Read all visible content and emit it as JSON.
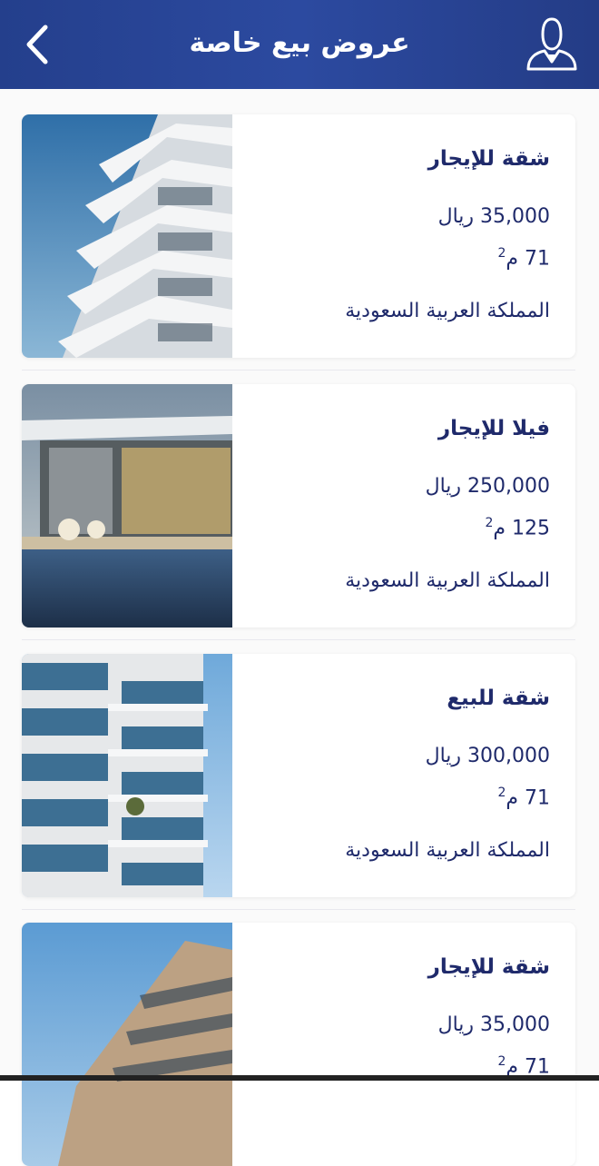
{
  "header": {
    "title": "عروض بيع خاصة",
    "back_icon": "chevron-left-icon",
    "profile_icon": "user-icon",
    "color": "#2c4aa0"
  },
  "listings": [
    {
      "title": "شقة للإيجار",
      "price": "35,000 ريال",
      "area": "71 م",
      "area_sup": "2",
      "location": "المملكة العربية السعودية"
    },
    {
      "title": "فيلا للإيجار",
      "price": "250,000 ريال",
      "area": "125 م",
      "area_sup": "2",
      "location": "المملكة العربية السعودية"
    },
    {
      "title": "شقة للبيع",
      "price": "300,000 ريال",
      "area": "71 م",
      "area_sup": "2",
      "location": "المملكة العربية السعودية"
    },
    {
      "title": "شقة للإيجار",
      "price": "35,000 ريال",
      "area": "71 م",
      "area_sup": "2",
      "location": ""
    }
  ]
}
